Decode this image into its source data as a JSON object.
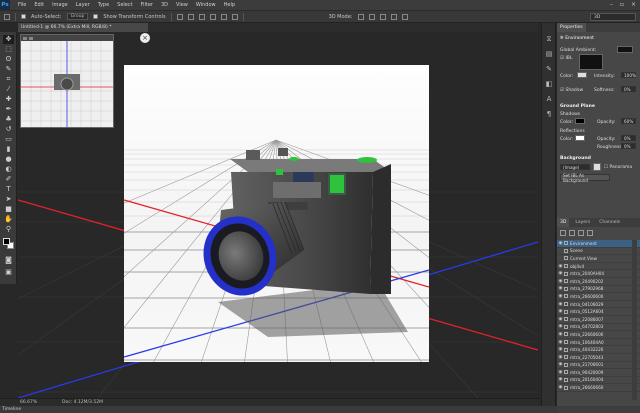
{
  "app": {
    "logo": "Ps"
  },
  "menu": [
    "File",
    "Edit",
    "Image",
    "Layer",
    "Type",
    "Select",
    "Filter",
    "3D",
    "View",
    "Window",
    "Help"
  ],
  "window_controls": {
    "minimize": "–",
    "maximize": "▫",
    "close": "×"
  },
  "options_bar": {
    "auto_select": "Auto-Select:",
    "group": "Group",
    "show_transform": "Show Transform Controls",
    "mode_3d": "3D Mode:",
    "workspace": "3D"
  },
  "document": {
    "tab_title": "Untitled-1 @ 66.7% (Extra Mill, RGB/8) *",
    "close_glyph": "×"
  },
  "status": {
    "zoom": "66.67%",
    "doc_info": "Doc: 4.12M/3.52M",
    "timeline": "Timeline"
  },
  "properties": {
    "tab": "Properties",
    "header": "Environment",
    "global_ambient": "Global Ambient:",
    "ibl": "IBL",
    "color": "Color:",
    "intensity": "Intensity:",
    "intensity_value": "100%",
    "shadow": "Shadow",
    "softness": "Softness:",
    "softness_value": "0%",
    "ground_plane": "Ground Plane",
    "shadows": "Shadows",
    "opacity": "Opacity:",
    "shadow_opacity": "60%",
    "reflections": "Reflections",
    "refl_opacity": "0%",
    "roughness": "Roughness:",
    "roughness_value": "0%",
    "background": "Background",
    "bg_select": "(Image)",
    "panorama": "Panorama",
    "set_bg": "Set IBL As Background"
  },
  "scene_panel": {
    "tabs": [
      "3D",
      "Layers",
      "Channels"
    ],
    "items": [
      "Environment",
      "Scene",
      "Current View",
      "obj4v4",
      "mtra_2040AH04",
      "mtra_20490202",
      "mtra_27902968",
      "mtra_26600600",
      "mtra_04106029",
      "mtra_0512A604",
      "mtra_22086007",
      "mtra_64702803",
      "mtra_22660606",
      "mtra_106404A0",
      "mtra_40432226",
      "mtra_22705043",
      "mtra_21706601",
      "mtra_90420009",
      "mtra_20160404",
      "mtra_26660660"
    ],
    "selected": 0
  },
  "colors": {
    "bg": "#282828",
    "panel": "#474747",
    "x_axis": "#e8202a",
    "z_axis": "#2a3ae8",
    "accent_green": "#2fc23c",
    "lens_blue": "#2530c8"
  }
}
